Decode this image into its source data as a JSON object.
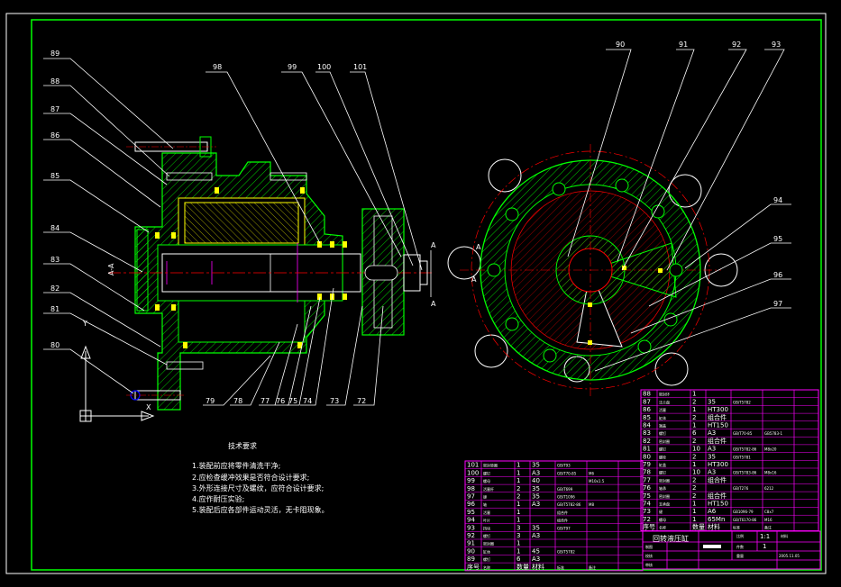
{
  "drawing": {
    "title": "回转液压缸",
    "scale_label": "比例",
    "scale_value": "1:1",
    "count_label": "件数",
    "count_value": "1",
    "weight_label": "重量",
    "material_label": "材料",
    "sheet_label": "共 张 第 张",
    "date_value": "2005.11.05",
    "drawn_label": "制图",
    "check_label": "校核",
    "approve_label": "审核"
  },
  "requirements": {
    "heading": "技术要求",
    "items": [
      "1.装配前应将零件清洗干净;",
      "2.应检查缓冲效果是否符合设计要求;",
      "3.外形连接尺寸及螺纹，应符合设计要求;",
      "4.应作耐压实验;",
      "5.装配后应各部件运动灵活，无卡阻现象。"
    ]
  },
  "balloons_left": [
    "89",
    "88",
    "87",
    "86",
    "85",
    "84",
    "83",
    "82",
    "81",
    "80"
  ],
  "balloons_top": [
    "98",
    "99",
    "100",
    "101"
  ],
  "balloons_bottom": [
    "79",
    "78",
    "77",
    "76",
    "75",
    "74",
    "73",
    "72"
  ],
  "balloons_right_top": [
    "90",
    "91",
    "92",
    "93"
  ],
  "balloons_right_side": [
    "94",
    "95",
    "96",
    "97"
  ],
  "section_marks": [
    "A",
    "A",
    "A",
    "A"
  ],
  "axis_labels": {
    "y": "Y",
    "x": "X"
  },
  "bom_right": [
    [
      "88",
      "密封环",
      "1",
      "",
      "",
      ""
    ],
    [
      "87",
      "法兰盘",
      "2",
      "35",
      "GB/T5782",
      ""
    ],
    [
      "86",
      "活塞",
      "1",
      "HT300",
      "",
      ""
    ],
    [
      "85",
      "缸体",
      "2",
      "组合件",
      "",
      ""
    ],
    [
      "84",
      "端盖",
      "1",
      "HT150",
      "",
      ""
    ],
    [
      "83",
      "螺钉",
      "6",
      "A3",
      "GB/T70-85",
      "GB5783-1"
    ],
    [
      "82",
      "密封圈",
      "2",
      "组合件",
      "",
      ""
    ],
    [
      "81",
      "螺钉",
      "10",
      "A3",
      "GB/T5782-86",
      "M8x20"
    ],
    [
      "80",
      "螺栓",
      "2",
      "35",
      "GB/T5781",
      ""
    ],
    [
      "79",
      "缸盖",
      "1",
      "HT300",
      "",
      ""
    ],
    [
      "78",
      "螺钉",
      "10",
      "A3",
      "GB/T5783-86",
      "M8x16"
    ],
    [
      "77",
      "密封圈",
      "2",
      "组合件",
      "",
      ""
    ],
    [
      "76",
      "轴承",
      "2",
      "",
      "GB/T276",
      "6212"
    ],
    [
      "75",
      "密封圈",
      "2",
      "组合件",
      "",
      ""
    ],
    [
      "74",
      "支承盘",
      "1",
      "HT150",
      "",
      ""
    ],
    [
      "73",
      "键",
      "1",
      "A6",
      "GB1096-79",
      "C8x7"
    ],
    [
      "72",
      "螺母",
      "1",
      "65Mn",
      "GB/T6170-86",
      "M16"
    ],
    [
      "序号",
      "名称",
      "数量",
      "材料",
      "标准",
      "备注"
    ]
  ],
  "bom_left": [
    [
      "101",
      "密封垫圈",
      "1",
      "35",
      "GB/T93",
      ""
    ],
    [
      "100",
      "螺钉",
      "1",
      "A3",
      "GB/T70-85",
      "M6"
    ],
    [
      "99",
      "螺母",
      "1",
      "40",
      "",
      "M10x1.5"
    ],
    [
      "98",
      "活塞杆",
      "2",
      "35",
      "GB/T699",
      ""
    ],
    [
      "97",
      "键",
      "2",
      "35",
      "GB/T1096",
      ""
    ],
    [
      "96",
      "轴",
      "1",
      "A3",
      "GB/T5782-86",
      "M8"
    ],
    [
      "95",
      "活塞",
      "1",
      "",
      "组合件",
      ""
    ],
    [
      "94",
      "叶片",
      "1",
      "",
      "组合件",
      ""
    ],
    [
      "93",
      "挡块",
      "3",
      "35",
      "GB/T97",
      ""
    ],
    [
      "92",
      "螺钉",
      "3",
      "A3",
      "",
      ""
    ],
    [
      "91",
      "密封圈",
      "1",
      "",
      "",
      ""
    ],
    [
      "90",
      "缸体",
      "1",
      "45",
      "GB/T5782",
      ""
    ],
    [
      "89",
      "螺钉",
      "6",
      "A3",
      "",
      ""
    ],
    [
      "序号",
      "名称",
      "数量",
      "材料",
      "标准",
      "备注"
    ]
  ],
  "colors": {
    "frame": "#00ff00",
    "hatch": "#00ff00",
    "centerline": "#ff0000",
    "leader": "#ffffff",
    "table_line": "#ff00ff",
    "part_line": "#ffff00",
    "axis": "#ffffff",
    "blue": "#0000ff"
  }
}
